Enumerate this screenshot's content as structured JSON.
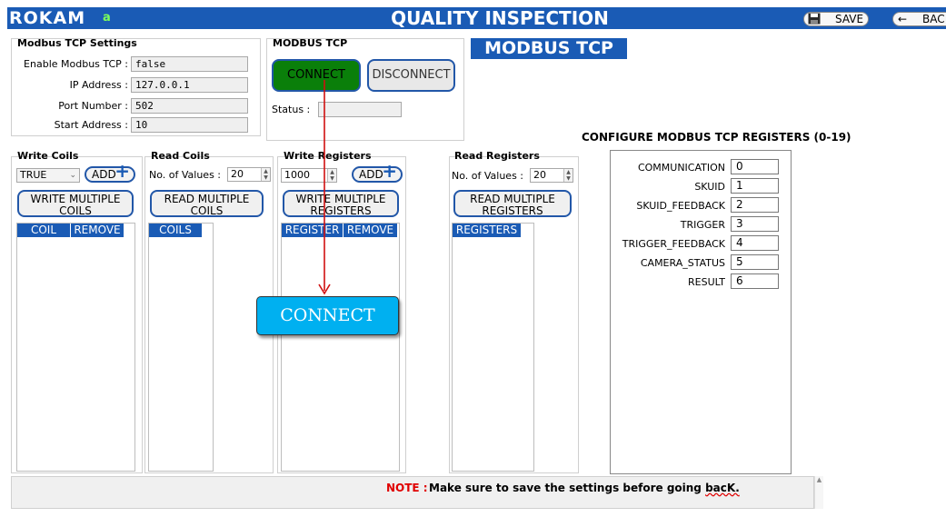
{
  "header": {
    "logo": "ROKAM",
    "logo_sub": "a",
    "title": "QUALITY INSPECTION",
    "save_label": "SAVE",
    "back_label": "BAC",
    "save_icon": "floppy-disk-icon",
    "back_icon": "arrow-left-icon"
  },
  "tcp_settings": {
    "title": "Modbus TCP Settings",
    "fields": [
      {
        "label": "Enable Modbus TCP :",
        "value": "false"
      },
      {
        "label": "IP Address :",
        "value": "127.0.0.1"
      },
      {
        "label": "Port Number :",
        "value": "502"
      },
      {
        "label": "Start Address :",
        "value": "10"
      }
    ]
  },
  "modbus_tcp": {
    "title": "MODBUS TCP",
    "connect_label": "CONNECT",
    "disconnect_label": "DISCONNECT",
    "status_label": "Status :",
    "status_value": "",
    "badge": "MODBUS TCP"
  },
  "write_coils": {
    "title": "Write Coils",
    "selected": "TRUE",
    "add_label": "ADD",
    "button": "WRITE MULTIPLE COILS",
    "columns": [
      "COIL",
      "REMOVE"
    ]
  },
  "read_coils": {
    "title": "Read Coils",
    "count_label": "No. of Values :",
    "count_value": "20",
    "button": "READ MULTIPLE COILS",
    "columns": [
      "COILS"
    ]
  },
  "write_registers": {
    "title": "Write Registers",
    "value": "1000",
    "add_label": "ADD",
    "button": "WRITE MULTIPLE REGISTERS",
    "columns": [
      "REGISTER",
      "REMOVE"
    ]
  },
  "read_registers": {
    "title": "Read Registers",
    "count_label": "No. of Values :",
    "count_value": "20",
    "button": "READ MULTIPLE REGISTERS",
    "columns": [
      "REGISTERS"
    ]
  },
  "configure": {
    "title": "CONFIGURE MODBUS TCP REGISTERS (0-19)",
    "registers": [
      {
        "name": "COMMUNICATION",
        "value": "0"
      },
      {
        "name": "SKUID",
        "value": "1"
      },
      {
        "name": "SKUID_FEEDBACK",
        "value": "2"
      },
      {
        "name": "TRIGGER",
        "value": "3"
      },
      {
        "name": "TRIGGER_FEEDBACK",
        "value": "4"
      },
      {
        "name": "CAMERA_STATUS",
        "value": "5"
      },
      {
        "name": "RESULT",
        "value": "6"
      }
    ]
  },
  "callout": {
    "text": "CONNECT"
  },
  "note": {
    "label": "NOTE :",
    "text_main": "Make sure to save the settings before going",
    "text_last": "bacK."
  },
  "colors": {
    "header_blue": "#1a5bb5",
    "connect_green": "#0a7f0a",
    "callout_cyan": "#00b0f0",
    "note_red": "#e00000"
  }
}
